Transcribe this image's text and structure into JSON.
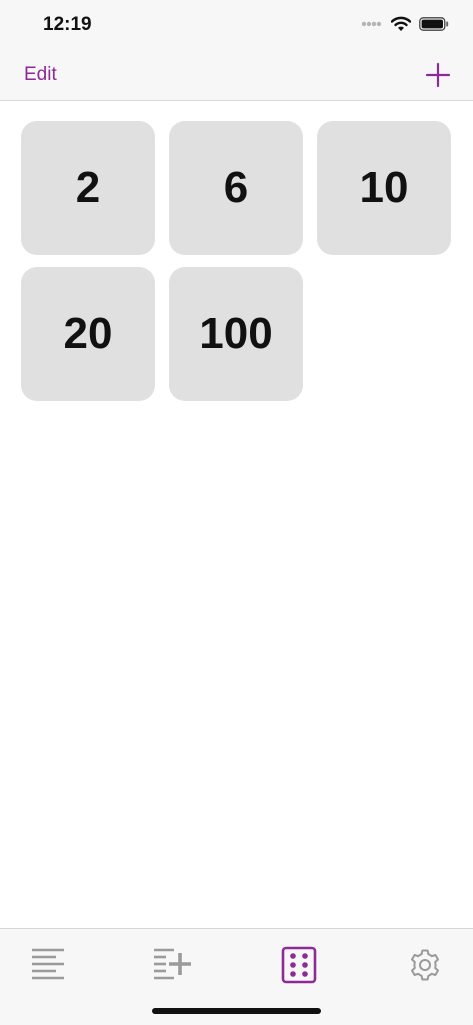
{
  "status": {
    "time": "12:19"
  },
  "nav": {
    "edit_label": "Edit"
  },
  "dice": [
    {
      "label": "2"
    },
    {
      "label": "6"
    },
    {
      "label": "10"
    },
    {
      "label": "20"
    },
    {
      "label": "100"
    }
  ],
  "colors": {
    "accent": "#8e2a96",
    "tile_bg": "#e0e0e0",
    "inactive_icon": "#9a9a9a"
  },
  "tabs": [
    {
      "icon": "list-icon",
      "active": false
    },
    {
      "icon": "list-add-icon",
      "active": false
    },
    {
      "icon": "dice-icon",
      "active": true
    },
    {
      "icon": "gear-icon",
      "active": false
    }
  ]
}
